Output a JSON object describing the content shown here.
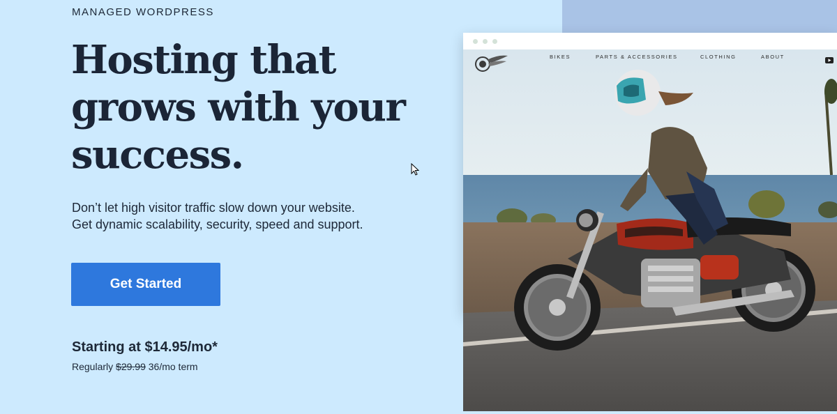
{
  "hero": {
    "eyebrow": "MANAGED WORDPRESS",
    "headline_line1": "Hosting that",
    "headline_line2": "grows with your",
    "headline_line3": "success.",
    "sub_line1": "Don’t let high visitor traffic slow down your website.",
    "sub_line2": "Get dynamic scalability, security, speed and support.",
    "cta_label": "Get Started",
    "price_label": "Starting at $14.95/mo*",
    "regular_prefix": "Regularly",
    "regular_price": "$29.99",
    "regular_term": "36/mo term"
  },
  "mockup": {
    "nav": [
      "BIKES",
      "PARTS & ACCESSORIES",
      "CLOTHING",
      "ABOUT"
    ],
    "logo_icon": "wing-wheel-logo-icon",
    "video_icon": "youtube-icon"
  },
  "colors": {
    "background": "#cdeafe",
    "right_panel": "#a9c3e6",
    "cta": "#2e78dd",
    "text": "#1d2837"
  }
}
